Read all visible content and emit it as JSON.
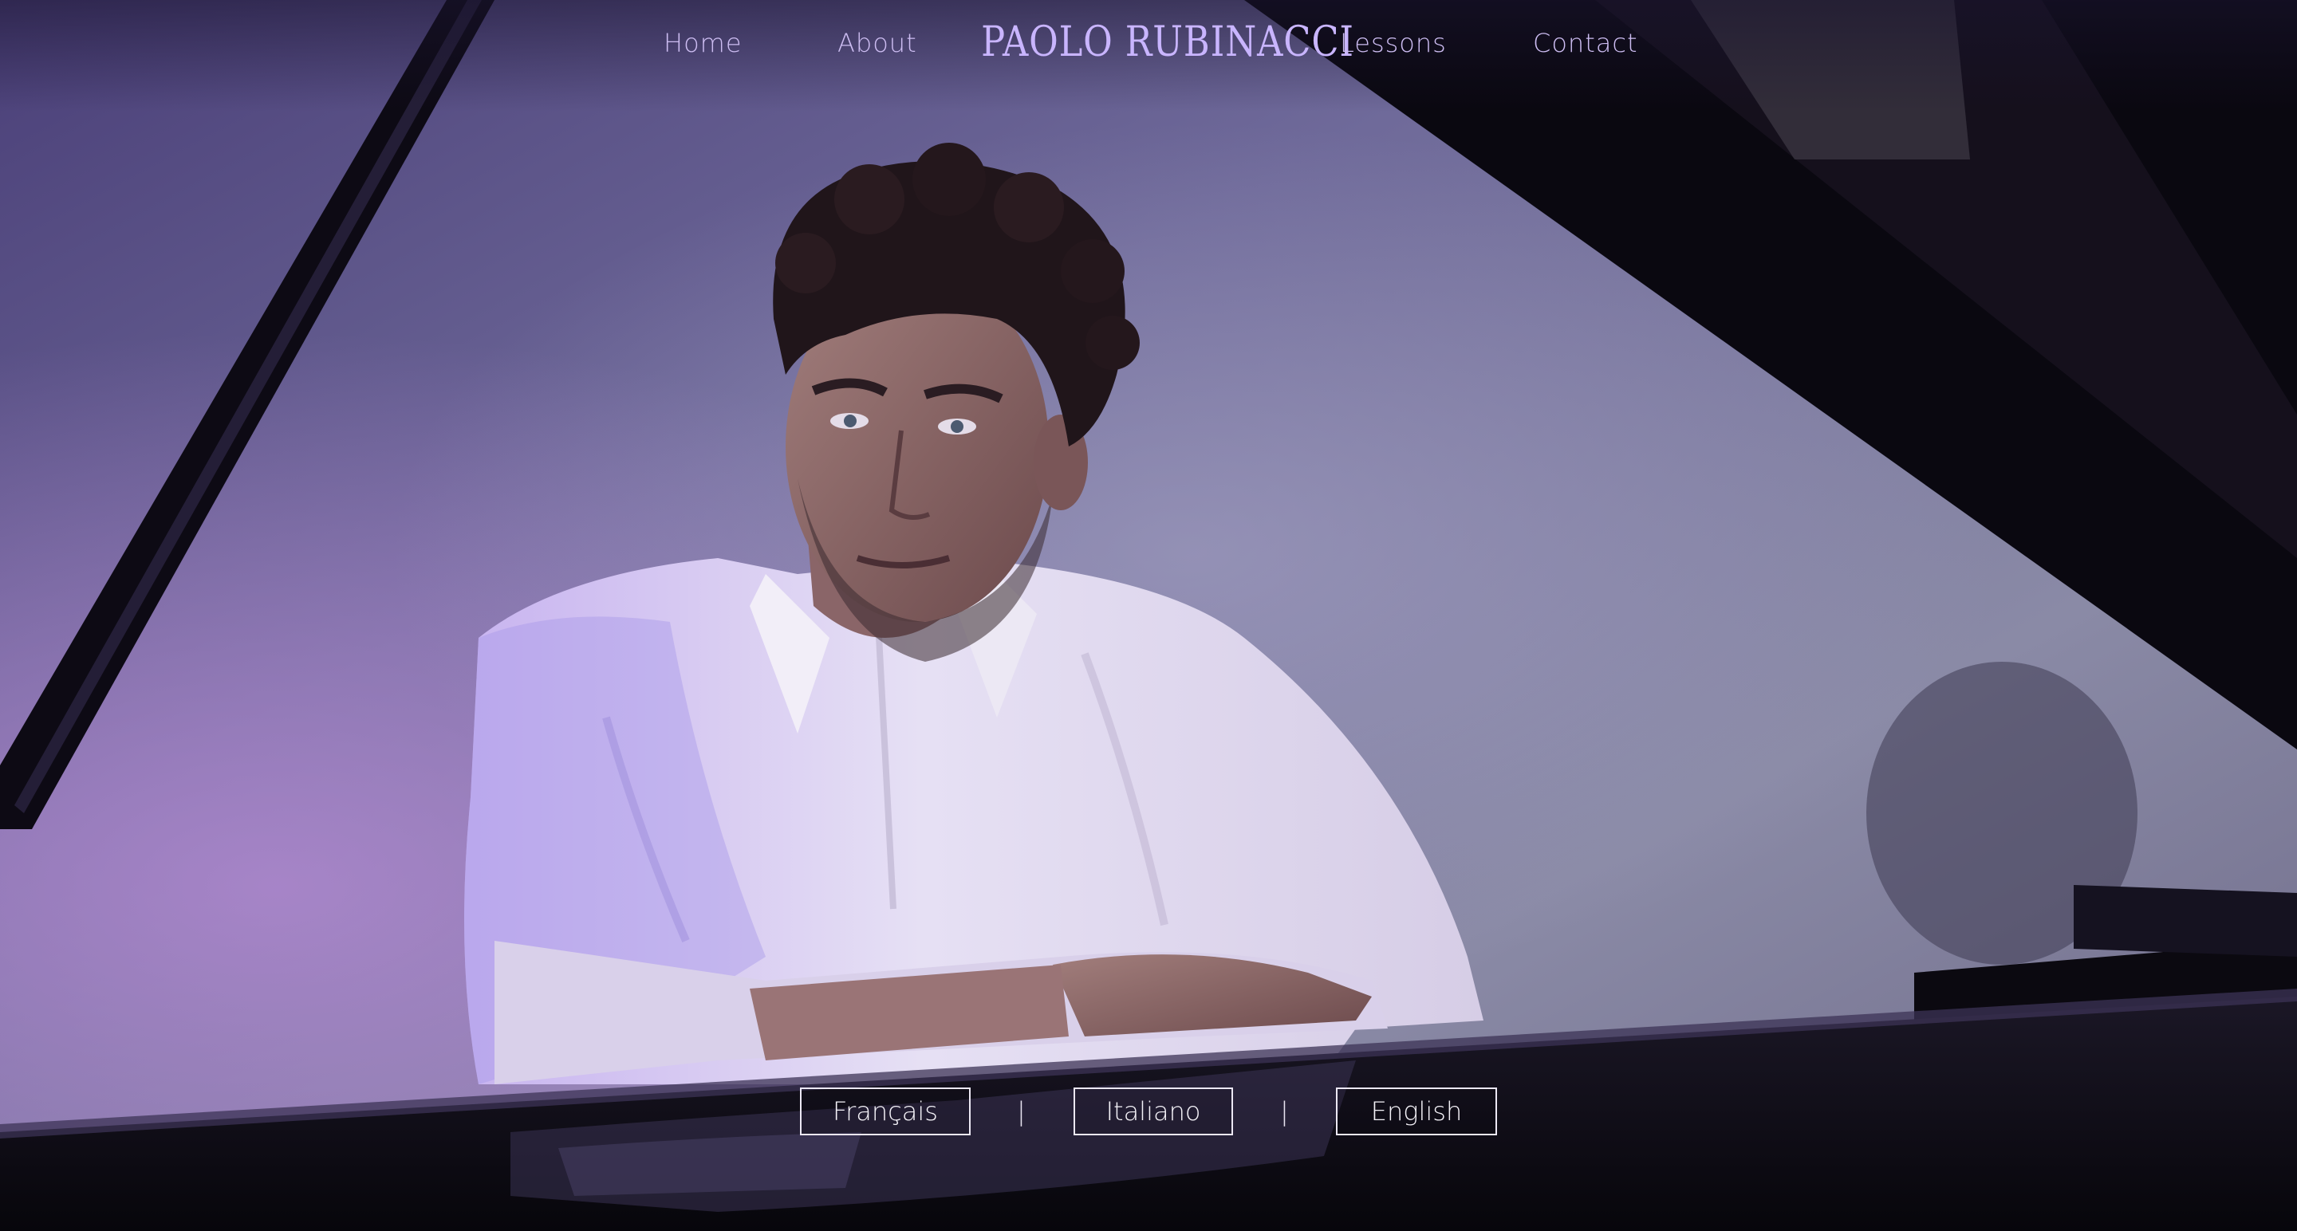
{
  "nav": {
    "home_label": "Home",
    "about_label": "About",
    "logo_text": "PAOLO RUBINACCI",
    "lessons_label": "Lessons",
    "contact_label": "Contact"
  },
  "languages": {
    "french_label": "Français",
    "italian_label": "Italiano",
    "english_label": "English",
    "separator": "|"
  },
  "colors": {
    "nav_text": "#cdbdf2",
    "logo": "#c9b5ff",
    "language_border": "#ece8f4"
  }
}
